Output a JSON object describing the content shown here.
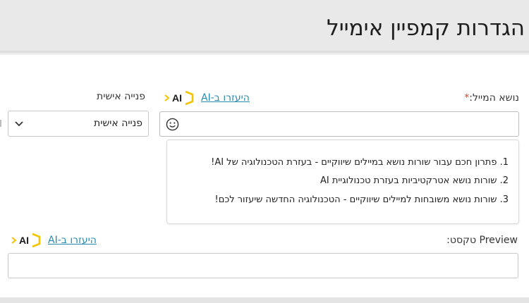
{
  "header": {
    "title": "הגדרות קמפיין אימייל"
  },
  "subject": {
    "label": "נושא המייל:",
    "required_mark": "*",
    "ai_link": "היעזרו ב-AI",
    "ai_badge": "AI",
    "emoji_icon": "smiley-icon"
  },
  "personal": {
    "label": "פנייה אישית",
    "selected": "פנייה אישית"
  },
  "suggestions": {
    "items": [
      "1. פתרון חכם עבור שורות נושא במיילים שיווקיים - בעזרת הטכנולוגיה של AI!",
      "2. שורות נושא אטרקטיביות בעזרת טכנולוגיית AI",
      "3. שורות נושא משובחות למיילים שיווקיים - הטכנולוגיה החדשה שיעזור לכם!"
    ]
  },
  "preview": {
    "label": "Preview טקסט:",
    "ai_link": "היעזרו ב-AI",
    "ai_badge": "AI"
  },
  "colors": {
    "header_bg": "#e9e9e9",
    "link": "#2a8bb0",
    "required": "#e0403a",
    "ai_accent": "#f2c400"
  }
}
